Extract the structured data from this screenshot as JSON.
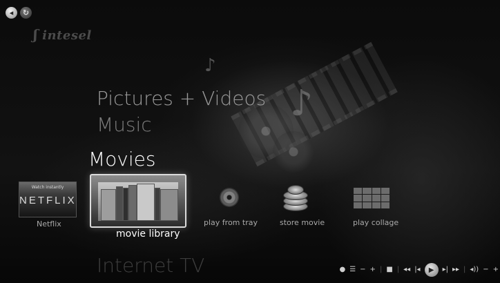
{
  "nav": {
    "back_icon": "back-arrow-icon",
    "sync_icon": "sync-icon"
  },
  "brand": {
    "logo_text": "intesel"
  },
  "menu": {
    "pictures_videos": "Pictures + Videos",
    "music": "Music",
    "movies": "Movies",
    "internet_tv": "Internet TV"
  },
  "tiles": [
    {
      "id": "netflix",
      "label": "Netflix",
      "tag": "Watch instantly",
      "wordmark": "NETFLIX",
      "selected": false
    },
    {
      "id": "movie_library",
      "label": "movie library",
      "selected": true
    },
    {
      "id": "play_from_tray",
      "label": "play from tray",
      "selected": false
    },
    {
      "id": "store_movie",
      "label": "store movie",
      "selected": false
    },
    {
      "id": "play_collage",
      "label": "play collage",
      "selected": false
    }
  ],
  "transport": {
    "record": "●",
    "guide": "☰",
    "channel_down": "−",
    "channel_up": "+",
    "stop": "■",
    "rewind": "◂◂",
    "prev": "|◂",
    "play": "▶",
    "next": "▸|",
    "fast_forward": "▸▸",
    "volume": "◂))",
    "vol_down": "−",
    "vol_up": "+"
  }
}
